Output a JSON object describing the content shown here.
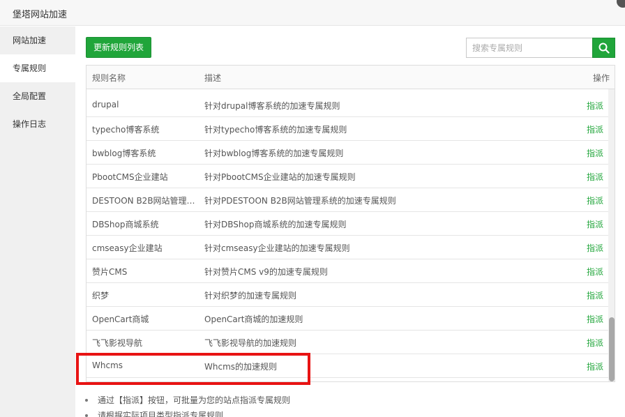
{
  "window": {
    "title": "堡塔网站加速"
  },
  "sidebar": {
    "items": [
      {
        "label": "网站加速"
      },
      {
        "label": "专属规则"
      },
      {
        "label": "全局配置"
      },
      {
        "label": "操作日志"
      }
    ],
    "active_index": 1
  },
  "toolbar": {
    "refresh_label": "更新规则列表"
  },
  "search": {
    "placeholder": "搜索专属规则"
  },
  "table": {
    "headers": {
      "name": "规则名称",
      "desc": "描述",
      "action": "操作"
    },
    "rows": [
      {
        "name": "drupal",
        "desc": "针对drupal博客系统的加速专属规则",
        "action": "指派"
      },
      {
        "name": "typecho博客系统",
        "desc": "针对typecho博客系统的加速专属规则",
        "action": "指派"
      },
      {
        "name": "bwblog博客系统",
        "desc": "针对bwblog博客系统的加速专属规则",
        "action": "指派"
      },
      {
        "name": "PbootCMS企业建站",
        "desc": "针对PbootCMS企业建站的加速专属规则",
        "action": "指派"
      },
      {
        "name": "DESTOON B2B网站管理…",
        "desc": "针对PDESTOON B2B网站管理系统的加速专属规则",
        "action": "指派"
      },
      {
        "name": "DBShop商城系统",
        "desc": "针对DBShop商城系统的加速专属规则",
        "action": "指派"
      },
      {
        "name": "cmseasy企业建站",
        "desc": "针对cmseasy企业建站的加速专属规则",
        "action": "指派"
      },
      {
        "name": "赞片CMS",
        "desc": "针对赞片CMS v9的加速专属规则",
        "action": "指派"
      },
      {
        "name": "织梦",
        "desc": "针对织梦的加速专属规则",
        "action": "指派"
      },
      {
        "name": "OpenCart商城",
        "desc": "OpenCart商城的加速规则",
        "action": "指派"
      },
      {
        "name": "飞飞影视导航",
        "desc": "飞飞影视导航的加速规则",
        "action": "指派"
      },
      {
        "name": "Whcms",
        "desc": "Whcms的加速规则",
        "action": "指派"
      }
    ]
  },
  "tips": [
    "通过【指派】按钮，可批量为您的站点指派专属规则",
    "请根据实际项目类型指派专属规则"
  ],
  "colors": {
    "accent": "#20a53a",
    "highlight": "#e81313"
  }
}
